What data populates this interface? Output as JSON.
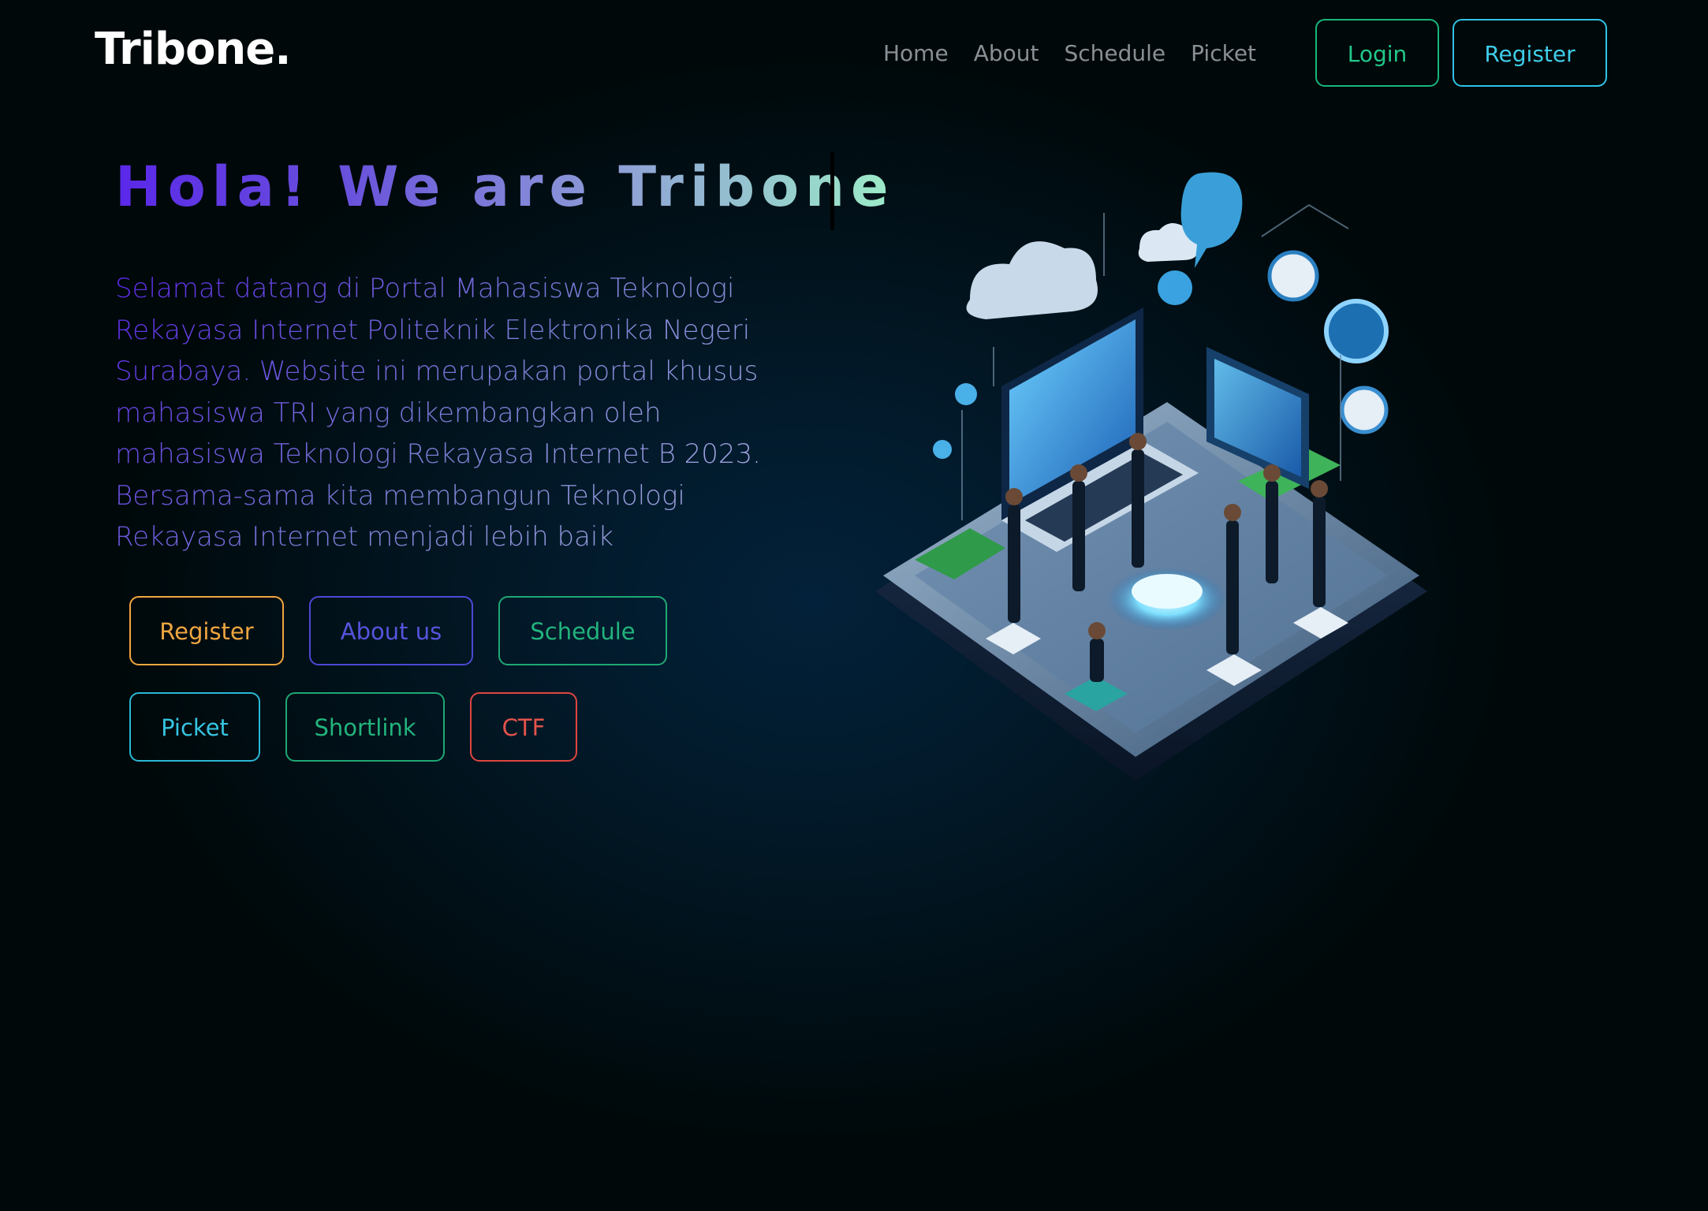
{
  "logo": "Tribone.",
  "nav": {
    "items": [
      {
        "label": "Home"
      },
      {
        "label": "About"
      },
      {
        "label": "Schedule"
      },
      {
        "label": "Picket"
      }
    ]
  },
  "header_buttons": {
    "login": "Login",
    "register": "Register"
  },
  "hero": {
    "headline": "Hola! We are Tribone",
    "description": "Selamat datang di Portal Mahasiswa Teknologi Rekayasa Internet Politeknik Elektronika Negeri Surabaya. Website ini merupakan portal khusus mahasiswa TRI yang dikembangkan oleh mahasiswa Teknologi Rekayasa Internet B 2023. Bersama-sama kita membangun Teknologi Rekayasa Internet menjadi lebih baik"
  },
  "actions": [
    {
      "label": "Register",
      "color": "#f0a640"
    },
    {
      "label": "About us",
      "color": "#4d48d6"
    },
    {
      "label": "Schedule",
      "color": "#1fa873"
    },
    {
      "label": "Picket",
      "color": "#2ab8d6"
    },
    {
      "label": "Shortlink",
      "color": "#1fa873"
    },
    {
      "label": "CTF",
      "color": "#e0463f"
    }
  ],
  "colors": {
    "background": "#021a2b",
    "headline_start": "#5a27e8",
    "headline_end": "#9cecc7"
  }
}
